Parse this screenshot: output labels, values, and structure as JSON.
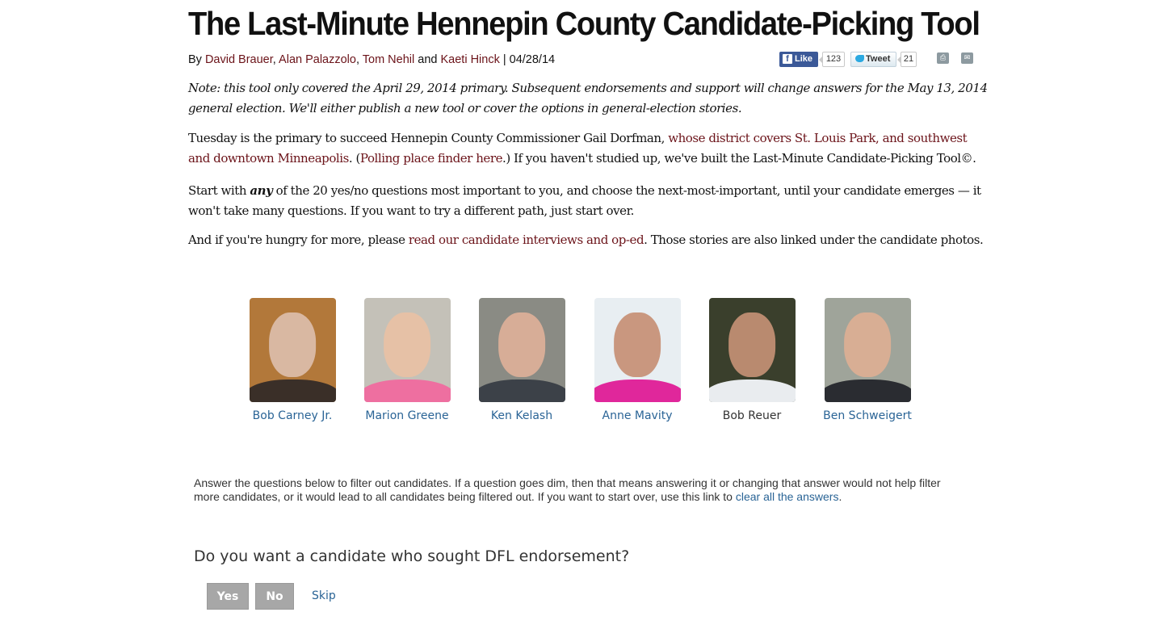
{
  "article": {
    "title": "The Last-Minute Hennepin County Candidate-Picking Tool",
    "byline": {
      "prefix": "By ",
      "authors": [
        "David Brauer",
        "Alan Palazzolo",
        "Tom Nehil",
        "Kaeti Hinck"
      ],
      "sep1": ", ",
      "sep2": ", ",
      "and": " and ",
      "date": " | 04/28/14"
    },
    "social": {
      "like_label": "Like",
      "like_count": "123",
      "tweet_label": "Tweet",
      "tweet_count": "21"
    },
    "note": "Note: this tool only covered the April 29, 2014 primary. Subsequent endorsements and support will change answers for the May 13, 2014 general election. We'll either publish a new tool or cover the options in general-election stories.",
    "p1": {
      "t1": "Tuesday is the primary to succeed Hennepin County Commissioner Gail Dorfman, ",
      "link1": "whose district covers St. Louis Park, and southwest and downtown Minneapolis",
      "t2": ". (",
      "link2": "Polling place finder here",
      "t3": ".) If you haven't studied up, we've built the Last-Minute Candidate-Picking Tool©."
    },
    "p2": {
      "t1": "Start with ",
      "emph": "any",
      "t2": " of the 20 yes/no questions most important to you, and choose the next-most-important, until your candidate emerges — it won't take many questions. If you want to try a different path, just start over."
    },
    "p3": {
      "t1": "And if you're hungry for more, please ",
      "link": "read our candidate interviews and op-ed",
      "t2": ". Those stories are also linked under the candidate photos."
    }
  },
  "candidates": [
    {
      "name": "Bob Carney Jr."
    },
    {
      "name": "Marion Greene"
    },
    {
      "name": "Ken Kelash"
    },
    {
      "name": "Anne Mavity"
    },
    {
      "name": "Bob Reuer"
    },
    {
      "name": "Ben Schweigert"
    }
  ],
  "instructions": {
    "text": "Answer the questions below to filter out candidates. If a question goes dim, then that means answering it or changing that answer would not help filter more candidates, or it would lead to all candidates being filtered out. If you want to start over, use this link to ",
    "link": "clear all the answers",
    "end": "."
  },
  "question": {
    "text": "Do you want a candidate who sought DFL endorsement?",
    "yes_label": "Yes",
    "no_label": "No",
    "skip_label": "Skip"
  },
  "colors": {
    "link_maroon": "#6b1319",
    "link_blue": "#2a6496",
    "button_gray": "#a7a7a7"
  }
}
